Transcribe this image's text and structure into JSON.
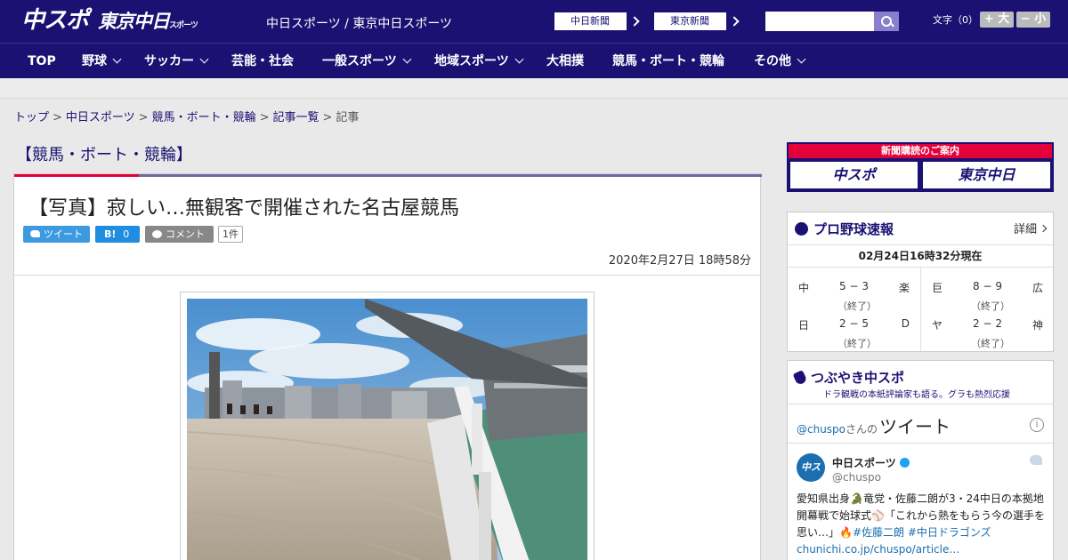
{
  "header": {
    "logo": "中スポ",
    "logo2": "東京中日",
    "logo2_small": "スポーツ",
    "tagline": "中日スポーツ / 東京中日スポーツ",
    "paper_buttons": [
      "中日新聞",
      "東京新聞"
    ],
    "search_placeholder": "",
    "font_size_label": "文字（0）",
    "font_plus": "+ 大",
    "font_minus": "− 小"
  },
  "nav": {
    "items": [
      {
        "label": "TOP"
      },
      {
        "label": "野球"
      },
      {
        "label": "サッカー"
      },
      {
        "label": "芸能・社会"
      },
      {
        "label": "一般スポーツ"
      },
      {
        "label": "地域スポーツ"
      },
      {
        "label": "大相撲"
      },
      {
        "label": "競馬・ボート・競輪"
      },
      {
        "label": "その他"
      }
    ]
  },
  "breadcrumb": {
    "items": [
      "トップ",
      "中日スポーツ",
      "競馬・ボート・競輪",
      "記事一覧"
    ],
    "current": "記事",
    "separator": ">"
  },
  "article": {
    "section": "【競馬・ボート・競輪】",
    "title": "【写真】寂しい…無観客で開催された名古屋競馬",
    "tweet_label": "ツイート",
    "hatena_label": "B!",
    "hatena_count": "0",
    "comment_label": "コメント",
    "comment_count": "1件",
    "date": "2020年2月27日 18時58分"
  },
  "sidebar": {
    "ad": {
      "title": "新聞購読のご案内",
      "left": "中スポ",
      "right": "東京中日"
    },
    "baseball": {
      "title": "プロ野球速報",
      "more": "詳細",
      "as_of": "02月24日16時32分現在",
      "games": [
        {
          "home": "中",
          "score": "5 − 3",
          "away": "楽",
          "status": "（終了）"
        },
        {
          "home": "巨",
          "score": "8 − 9",
          "away": "広",
          "status": "（終了）"
        },
        {
          "home": "日",
          "score": "2 − 5",
          "away": "D",
          "status": "（終了）"
        },
        {
          "home": "ヤ",
          "score": "2 − 2",
          "away": "神",
          "status": "（終了）"
        }
      ]
    },
    "tweets": {
      "title": "つぶやき中スポ",
      "subtitle": "ドラ観戦の本紙評論家も語る。グラも熱烈応援",
      "handle_link": "@chuspo",
      "handle_suffix": "さんの",
      "heading": "ツイート",
      "info": "i",
      "avatar": "中スポ",
      "name": "中日スポーツ",
      "handle": "@chuspo",
      "text_1": "愛知県出身🐊竜党・佐藤二朗が3・24中日の本拠地開幕戦で始球式⚾「これから熱をもらう今の選手を思い…」🔥",
      "text_tags": "#佐藤二朗 #中日ドラゴンズ",
      "text_link": "chunichi.co.jp/chuspo/article…"
    }
  },
  "colors": {
    "brand": "#1b1172",
    "accent": "#e4003a",
    "link": "#1b6fb0"
  }
}
